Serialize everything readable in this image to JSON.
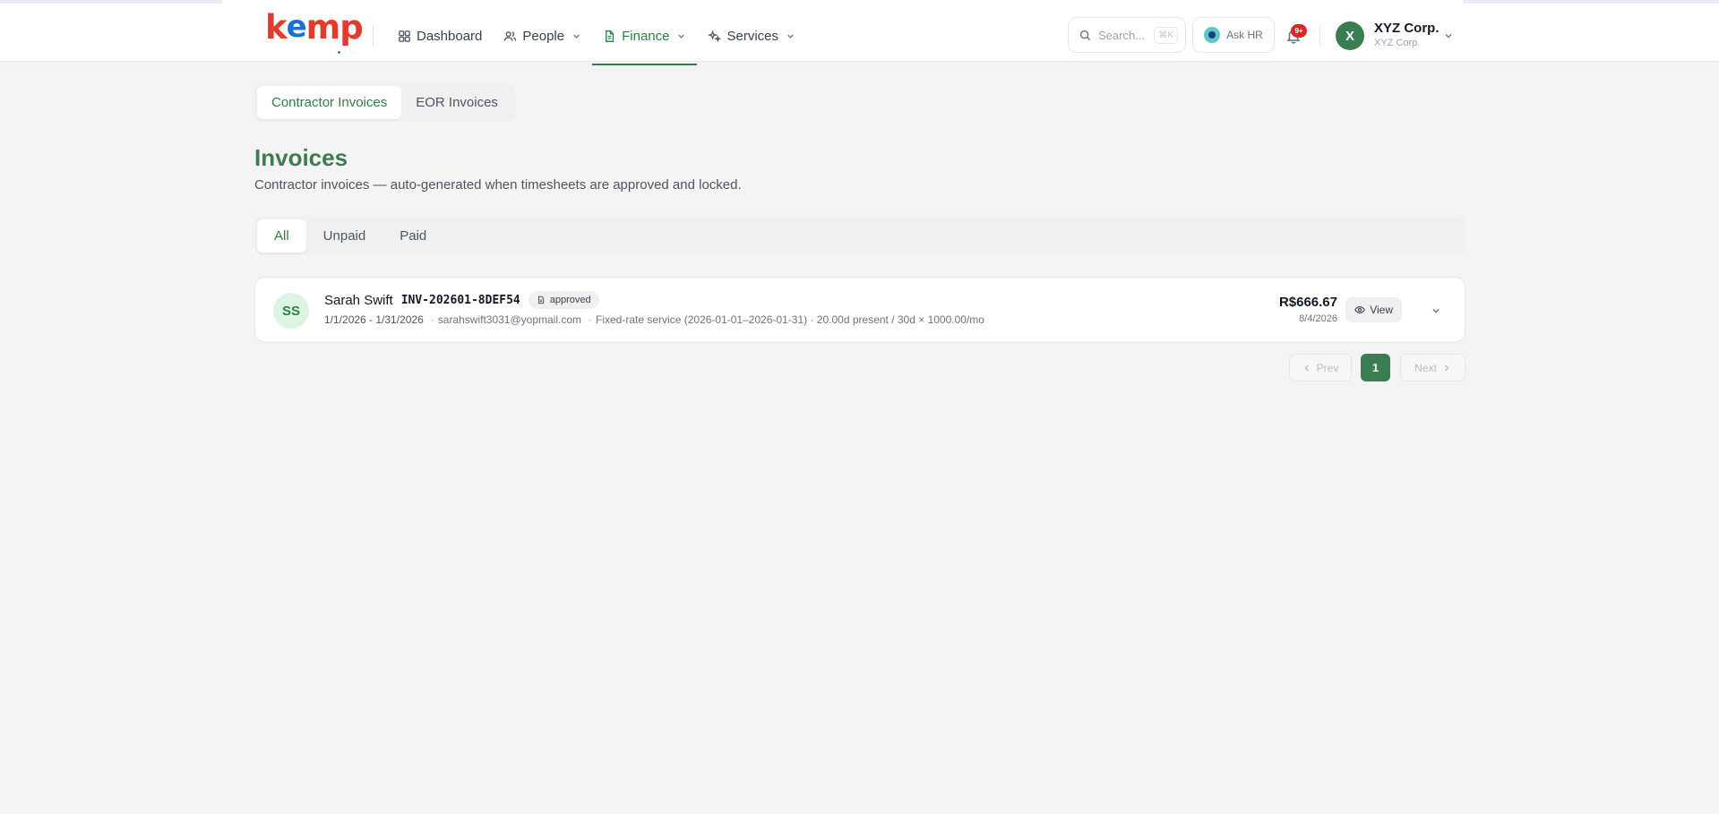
{
  "brand": {
    "logo_text_a": "k",
    "logo_text_o": "e",
    "logo_text_b": "mp"
  },
  "nav": {
    "dashboard": "Dashboard",
    "people": "People",
    "finance": "Finance",
    "services": "Services"
  },
  "search": {
    "placeholder": "Search...",
    "shortcut": "⌘K"
  },
  "ask_hr": "Ask HR",
  "notifications": {
    "badge": "9+"
  },
  "org": {
    "initial": "X",
    "name": "XYZ Corp.",
    "sub": "XYZ Corp."
  },
  "invoice_tabs": {
    "contractor": "Contractor Invoices",
    "eor": "EOR Invoices"
  },
  "page": {
    "title": "Invoices",
    "subtitle": "Contractor invoices — auto-generated when timesheets are approved and locked."
  },
  "filters": {
    "all": "All",
    "unpaid": "Unpaid",
    "paid": "Paid"
  },
  "invoices": [
    {
      "initials": "SS",
      "name": "Sarah Swift",
      "number": "INV-202601-8DEF54",
      "status": "approved",
      "period": "1/1/2026 - 1/31/2026",
      "email": "sarahswift3031@yopmail.com",
      "details": "Fixed-rate service (2026-01-01–2026-01-31) · 20.00d present / 30d × 1000.00/mo",
      "amount": "R$666.67",
      "date": "8/4/2026",
      "view_label": "View"
    }
  ],
  "pagination": {
    "prev": "Prev",
    "current": "1",
    "next": "Next"
  },
  "colors": {
    "accent": "#2f7d47",
    "brand_red": "#e23b2e",
    "brand_blue": "#1d6fd1",
    "badge_red": "#dc2626"
  }
}
